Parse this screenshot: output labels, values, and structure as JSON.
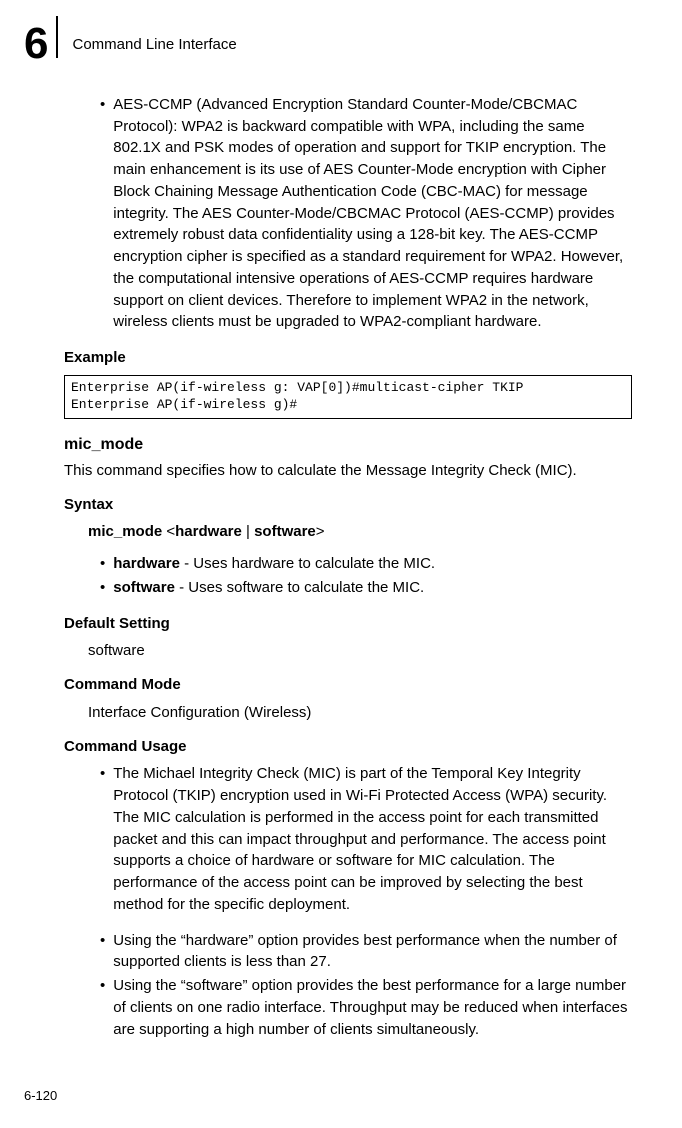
{
  "chapter": "6",
  "headerTitle": "Command Line Interface",
  "bullet1": "AES-CCMP (Advanced Encryption Standard Counter-Mode/CBCMAC Protocol): WPA2 is backward compatible with WPA, including the same 802.1X and PSK modes of operation and support for TKIP encryption. The main enhancement is its use of AES Counter-Mode encryption with Cipher Block Chaining Message Authentication Code (CBC-MAC) for message integrity. The AES Counter-Mode/CBCMAC Protocol (AES-CCMP) provides extremely robust data confidentiality using a 128-bit key. The AES-CCMP encryption cipher is specified as a standard requirement for WPA2. However, the computational intensive operations of AES-CCMP requires hardware support on client devices. Therefore to implement WPA2 in the network, wireless clients must be upgraded to WPA2-compliant hardware.",
  "exampleLabel": "Example",
  "codeLine1": "Enterprise AP(if-wireless g: VAP[0])#multicast-cipher TKIP",
  "codeLine2": "Enterprise AP(if-wireless g)#",
  "cmdName": "mic_mode",
  "cmdDesc": "This command specifies how to calculate the Message Integrity Check (MIC).",
  "syntaxLabel": "Syntax",
  "syntaxLinePrefixBold": "mic_mode",
  "syntaxLineMid": " <",
  "syntaxHardware": "hardware",
  "syntaxPipe": " | ",
  "syntaxSoftware": "software",
  "syntaxEnd": ">",
  "syntaxOpt1Bold": "hardware",
  "syntaxOpt1Rest": " - Uses hardware to calculate the MIC.",
  "syntaxOpt2Bold": "software",
  "syntaxOpt2Rest": " - Uses software to calculate the MIC.",
  "defaultLabel": "Default Setting",
  "defaultValue": "software",
  "modeLabel": "Command Mode",
  "modeValue": "Interface Configuration (Wireless)",
  "usageLabel": "Command Usage",
  "usage1": "The Michael Integrity Check (MIC) is part of the Temporal Key Integrity Protocol (TKIP) encryption used in Wi-Fi Protected Access (WPA) security. The MIC calculation is performed in the access point for each transmitted packet and this can impact throughput and performance. The access point supports a choice of hardware or software for MIC calculation. The performance of the access point can be improved by selecting the best method for the specific deployment.",
  "usage2": "Using the “hardware” option provides best performance when the number of supported clients is less than 27.",
  "usage3": "Using the “software” option provides the best performance for a large number of clients on one radio interface. Throughput may be reduced when interfaces are supporting a high number of clients simultaneously.",
  "pageNum": "6-120"
}
